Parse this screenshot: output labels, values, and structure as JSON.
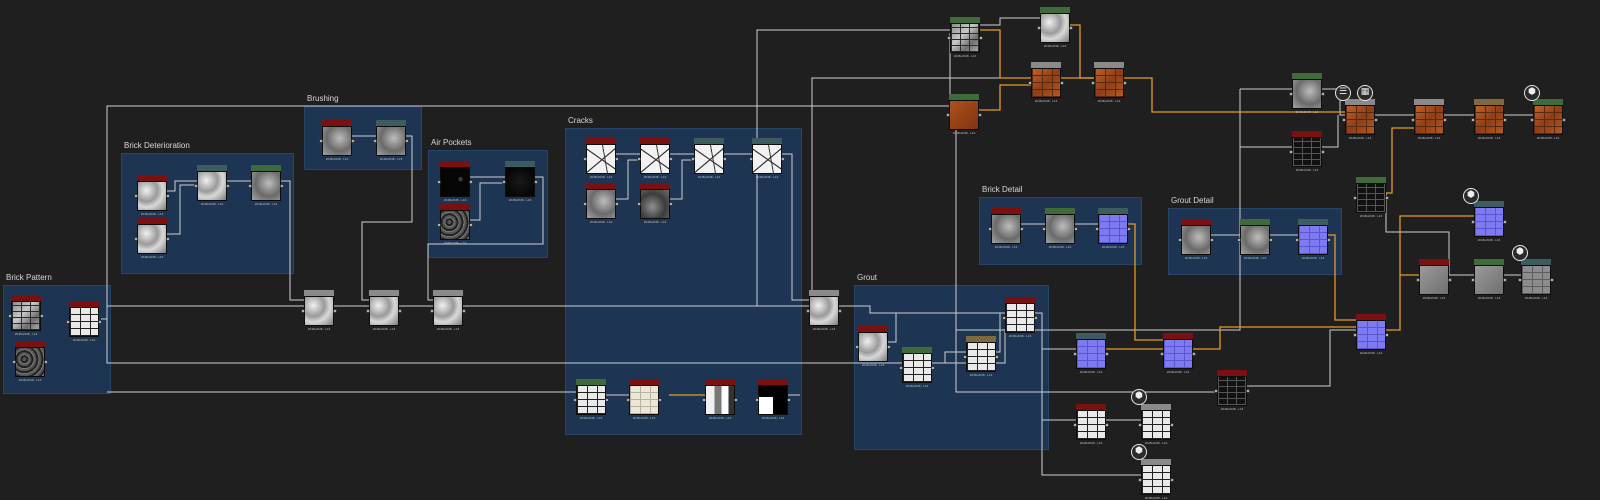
{
  "frames": [
    {
      "id": "brick-pattern",
      "title": "Brick Pattern"
    },
    {
      "id": "brick-deterioration",
      "title": "Brick Deterioration"
    },
    {
      "id": "brushing",
      "title": "Brushing"
    },
    {
      "id": "air-pockets",
      "title": "Air Pockets"
    },
    {
      "id": "cracks",
      "title": "Cracks"
    },
    {
      "id": "grout",
      "title": "Grout"
    },
    {
      "id": "brick-detail",
      "title": "Brick Detail"
    },
    {
      "id": "grout-detail",
      "title": "Grout Detail"
    }
  ],
  "node_meta": "2048x2048 - L16",
  "colors": {
    "red_header": "#7a1010",
    "green_header": "#3f6b3a",
    "gray_header": "#8a8a8a",
    "teal_header": "#3d5c60",
    "tan_header": "#7d6a3e",
    "wire": "#cfcfcf",
    "wire_orange": "#e59a28",
    "frame_fill": "#1d3552",
    "canvas": "#1f1f1f"
  },
  "badges": [
    {
      "icon": "document-icon"
    },
    {
      "icon": "checker-icon"
    },
    {
      "icon": "cube-icon"
    }
  ]
}
